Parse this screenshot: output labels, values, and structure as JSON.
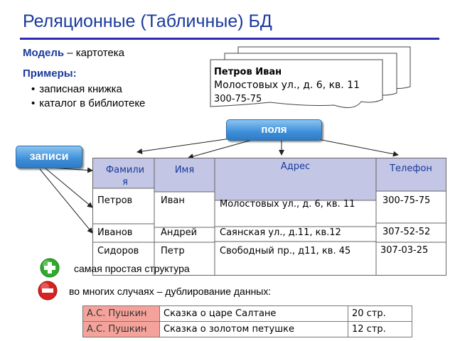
{
  "title": "Реляционные (Табличные) БД",
  "model": {
    "label": "Модель",
    "text": " – картотека"
  },
  "examples": {
    "label": "Примеры:",
    "items": [
      "записная книжка",
      "каталог в библиотеке"
    ]
  },
  "card": {
    "name": "Петров Иван",
    "address": "Молостовых ул., д. 6, кв. 11",
    "phone": "300-75-75"
  },
  "fields_label": "поля",
  "records_label": "записи",
  "table": {
    "headers": [
      "Фамили\nя",
      "Имя",
      "Адрес",
      "Телефон"
    ],
    "rows": [
      [
        "Петров",
        "Иван",
        "Молостовых ул., д. 6, кв. 11",
        "300-75-75"
      ],
      [
        "Иванов",
        "Андрей",
        "Саянская ул., д.11, кв.12",
        "307-52-52"
      ],
      [
        "Сидоров",
        "Петр",
        "Свободный пр., д11, кв. 45",
        "307-03-25"
      ]
    ]
  },
  "plus_note": "самая простая структура",
  "minus_note": "во многих случаях – дублирование данных:",
  "books": [
    {
      "author": "А.С. Пушкин",
      "title": "Сказка о царе Салтане",
      "pages": "20 стр."
    },
    {
      "author": "А.С. Пушкин",
      "title": "Сказка о золотом петушке",
      "pages": "12 стр."
    }
  ],
  "colors": {
    "title": "#1a3a9c",
    "pill": "#3d8fd8",
    "header_bg": "#c3c6e4",
    "author_bg": "#f5a39a",
    "plus": "#2faa2a",
    "minus": "#d8221f"
  }
}
